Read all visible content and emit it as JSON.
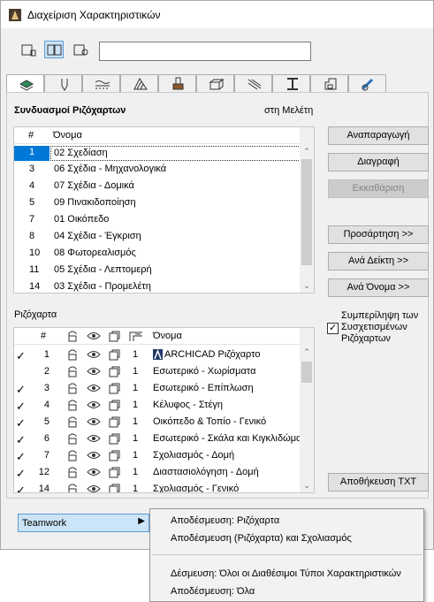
{
  "window": {
    "title": "Διαχείριση Χαρακτηριστικών"
  },
  "search": {
    "value": ""
  },
  "toolbar": {
    "view_modes": [
      "single-list-icon",
      "dual-list-icon",
      "detail-view-icon"
    ],
    "active_mode": 1
  },
  "tabs": [
    "layers-icon",
    "pen-icon",
    "line-type-icon",
    "fill-icon",
    "surface-icon",
    "building-material-icon",
    "composite-icon",
    "profile-icon",
    "zone-icon",
    "renovation-icon"
  ],
  "combinations": {
    "title": "Συνδυασμοί Ριζόχαρτων",
    "location": "στη Μελέτη",
    "header_num": "#",
    "header_name": "Όνομα",
    "rows": [
      {
        "num": "1",
        "name": "02 Σχεδίαση"
      },
      {
        "num": "3",
        "name": "06 Σχέδια - Μηχανολογικά"
      },
      {
        "num": "4",
        "name": "07 Σχέδια - Δομικά"
      },
      {
        "num": "5",
        "name": "09 Πινακιδοποίηση"
      },
      {
        "num": "7",
        "name": "01 Οικόπεδο"
      },
      {
        "num": "8",
        "name": "04 Σχέδια - Έγκριση"
      },
      {
        "num": "10",
        "name": "08 Φωτορεαλισμός"
      },
      {
        "num": "11",
        "name": "05 Σχέδια - Λεπτομερή"
      },
      {
        "num": "14",
        "name": "03 Σχέδια - Προμελέτη"
      }
    ]
  },
  "layers": {
    "title": "Ριζόχαρτα",
    "header_num": "#",
    "header_name": "Όνομα",
    "rows": [
      {
        "checked": true,
        "num": "1",
        "pen": "1",
        "name": "ARCHICAD Ριζόχαρτο",
        "archicad": true
      },
      {
        "checked": false,
        "num": "2",
        "pen": "1",
        "name": "Εσωτερικό - Χωρίσματα"
      },
      {
        "checked": true,
        "num": "3",
        "pen": "1",
        "name": "Εσωτερικό - Επίπλωση"
      },
      {
        "checked": true,
        "num": "4",
        "pen": "1",
        "name": "Κέλυφος - Στέγη"
      },
      {
        "checked": true,
        "num": "5",
        "pen": "1",
        "name": "Οικόπεδο & Τοπίο - Γενικό"
      },
      {
        "checked": true,
        "num": "6",
        "pen": "1",
        "name": "Εσωτερικό - Σκάλα και Κιγκλιδώματα"
      },
      {
        "checked": true,
        "num": "7",
        "pen": "1",
        "name": "Σχολιασμός - Δομή"
      },
      {
        "checked": true,
        "num": "12",
        "pen": "1",
        "name": "Διαστασιολόγηση - Δομή"
      },
      {
        "checked": true,
        "num": "14",
        "pen": "1",
        "name": "Σχολιασμός - Γενικό"
      }
    ]
  },
  "buttons": {
    "import": "Αναπαραγωγή",
    "delete": "Διαγραφή",
    "purge": "Εκκαθάριση",
    "append": "Προσάρτηση >>",
    "by_index": "Ανά Δείκτη >>",
    "by_name": "Ανά Όνομα >>",
    "save_txt": "Αποθήκευση TXT"
  },
  "include_related": {
    "label": "Συμπερίληψη των Συσχετισμένων Ριζόχαρτων",
    "checked": true
  },
  "teamwork": {
    "label": "Teamwork"
  },
  "menu": {
    "items": [
      "Αποδέσμευση: Ριζόχαρτα",
      "Αποδέσμευση (Ριζόχαρτα) και Σχολιασμός",
      "Δέσμευση: Όλοι οι Διαθέσιμοι Τύποι Χαρακτηριστικών",
      "Αποδέσμευση: Όλα"
    ]
  }
}
